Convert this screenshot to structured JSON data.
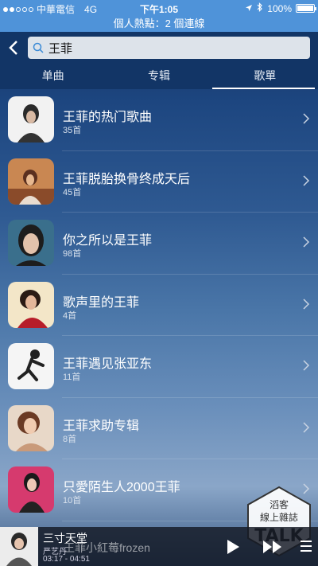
{
  "status_bar": {
    "carrier": "中華電信",
    "network": "4G",
    "time": "下午1:05",
    "battery": "100%",
    "battery_level": 1.0,
    "signal_bars_filled": 2
  },
  "hotspot_banner": "個人熱點：2 個連線",
  "search": {
    "value": "王菲",
    "placeholder": ""
  },
  "tabs": [
    {
      "label": "单曲",
      "active": false
    },
    {
      "label": "专辑",
      "active": false
    },
    {
      "label": "歌單",
      "active": true
    }
  ],
  "playlists": [
    {
      "title": "王菲的热门歌曲",
      "count": "35首"
    },
    {
      "title": "王菲脱胎换骨终成天后",
      "count": "45首"
    },
    {
      "title": "你之所以是王菲",
      "count": "98首"
    },
    {
      "title": "歌声里的王菲",
      "count": "4首"
    },
    {
      "title": "王菲遇见张亚东",
      "count": "11首"
    },
    {
      "title": "王菲求助专辑",
      "count": "8首"
    },
    {
      "title": "只愛陌生人2000王菲",
      "count": "10首"
    }
  ],
  "watermark": {
    "line1": "滔客",
    "line2": "線上雜誌",
    "logo": "TALK"
  },
  "player": {
    "title": "三寸天堂",
    "artist": "严艺丹",
    "elapsed": "03:17",
    "duration": "04:51",
    "time_separator": " - ",
    "marquee": "王菲小紅莓frozen"
  },
  "colors": {
    "status_bar": "#4f93d9",
    "header": "#123566"
  }
}
